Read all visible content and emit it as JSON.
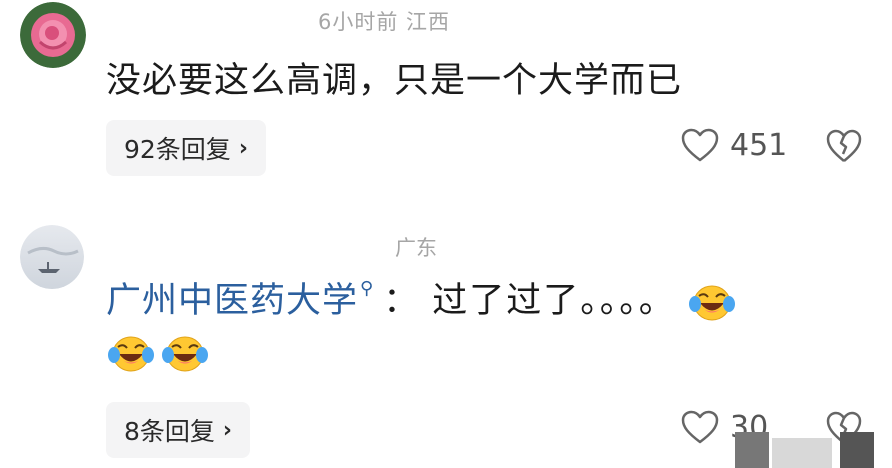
{
  "comments": [
    {
      "meta": "6小时前  江西",
      "text": "没必要这么高调，只是一个大学而已",
      "replies_label": "92条回复",
      "likes": "451"
    },
    {
      "meta": "广东",
      "mention": "广州中医药大学",
      "separator": "：",
      "text": "过了过了。。。。",
      "replies_label": "8条回复",
      "likes": "30"
    }
  ],
  "icons": {
    "like": "heart-outline-icon",
    "dislike": "broken-heart-icon",
    "emoji": "laughing-crying-emoji",
    "mention": "search-icon"
  }
}
